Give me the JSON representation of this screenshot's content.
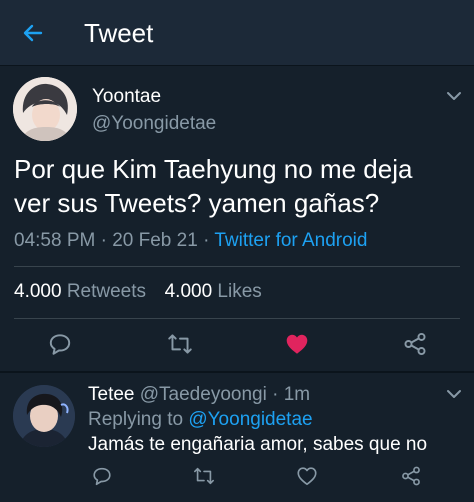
{
  "header": {
    "title": "Tweet"
  },
  "tweet": {
    "author_name": "Yoontae",
    "author_handle": "@Yoongidetae",
    "text_line1": "Por que Kim Taehyung no me deja",
    "text_line2": "ver sus Tweets? yamen gañas?",
    "time": "04:58 PM",
    "date": "20 Feb 21",
    "source": "Twitter for Android",
    "retweets_count": "4.000",
    "retweets_label": "Retweets",
    "likes_count": "4.000",
    "likes_label": "Likes"
  },
  "reply": {
    "author_name": "Tetee",
    "author_handle": "@Taedeyoongi",
    "age": "1m",
    "replying_prefix": "Replying to",
    "replying_handle": "@Yoongidetae",
    "text": "Jamás te engañaria amor, sabes que no"
  },
  "colors": {
    "background": "#15202b",
    "header": "#1c2938",
    "accent": "#1da1f2",
    "like": "#e0245e",
    "muted": "#8899a6"
  },
  "icons": [
    "back-arrow-icon",
    "chevron-down-icon",
    "reply-icon",
    "retweet-icon",
    "heart-icon",
    "share-icon"
  ]
}
